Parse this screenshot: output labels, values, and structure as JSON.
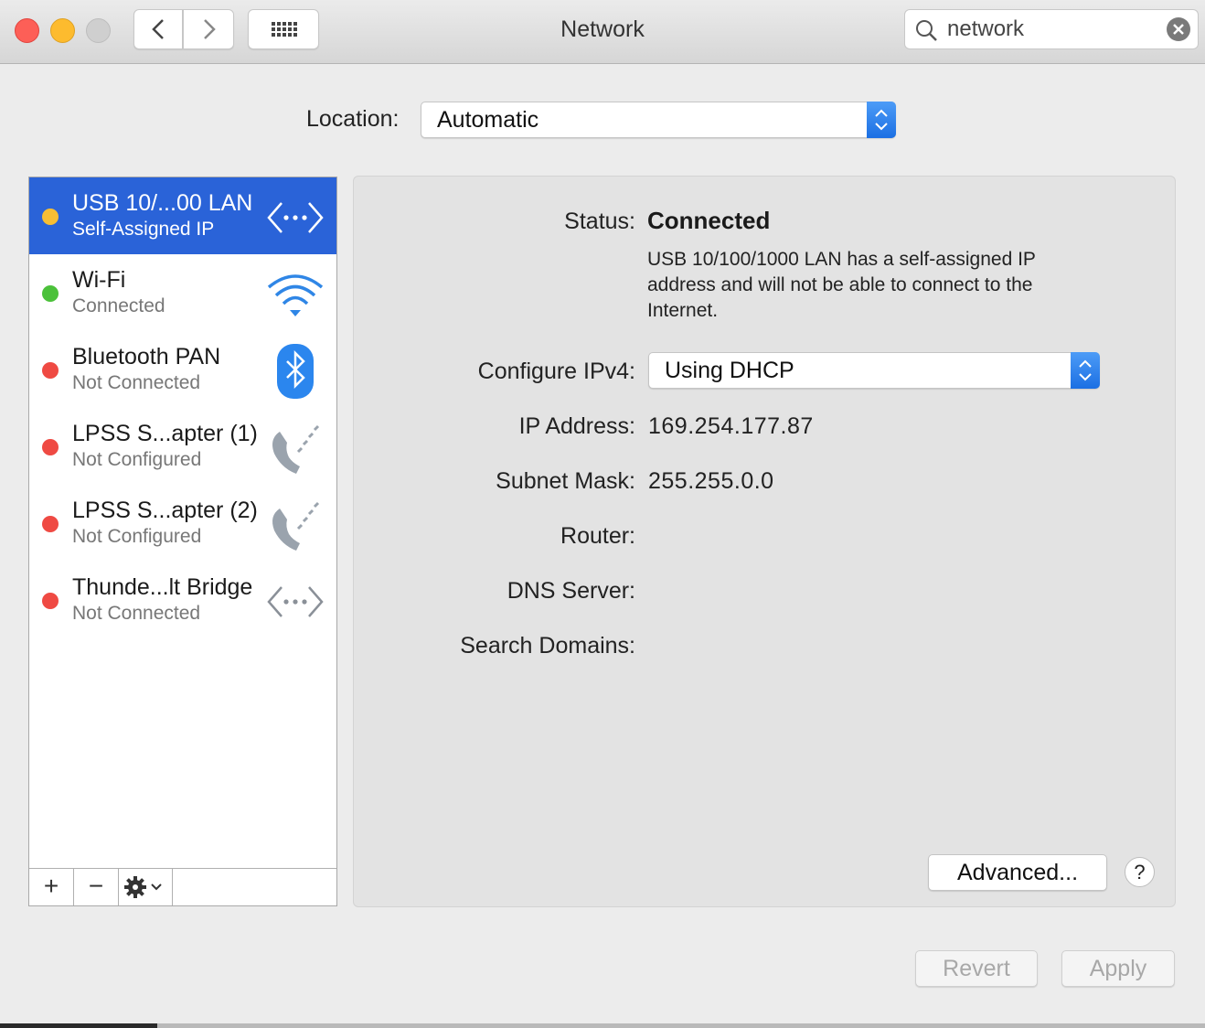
{
  "window": {
    "title": "Network"
  },
  "search": {
    "value": "network"
  },
  "location": {
    "label": "Location:",
    "value": "Automatic"
  },
  "services": [
    {
      "name": "USB 10/...00 LAN",
      "status": "Self-Assigned IP",
      "dot_color": "#f7be34",
      "icon": "ethernet-icon",
      "selected": true
    },
    {
      "name": "Wi-Fi",
      "status": "Connected",
      "dot_color": "#4bc13a",
      "icon": "wifi-icon"
    },
    {
      "name": "Bluetooth PAN",
      "status": "Not Connected",
      "dot_color": "#ef4a43",
      "icon": "bluetooth-icon"
    },
    {
      "name": "LPSS S...apter (1)",
      "status": "Not Configured",
      "dot_color": "#ef4a43",
      "icon": "phone-modem-icon"
    },
    {
      "name": "LPSS S...apter (2)",
      "status": "Not Configured",
      "dot_color": "#ef4a43",
      "icon": "phone-modem-icon"
    },
    {
      "name": "Thunde...lt Bridge",
      "status": "Not Connected",
      "dot_color": "#ef4a43",
      "icon": "ethernet-icon"
    }
  ],
  "tools": {
    "add": "+",
    "remove": "−"
  },
  "detail": {
    "status_label": "Status:",
    "status_value": "Connected",
    "status_description": "USB 10/100/1000 LAN has a self-assigned IP address and will not be able to connect to the Internet.",
    "configure_label": "Configure IPv4:",
    "configure_value": "Using DHCP",
    "ip_label": "IP Address:",
    "ip_value": "169.254.177.87",
    "subnet_label": "Subnet Mask:",
    "subnet_value": "255.255.0.0",
    "router_label": "Router:",
    "dns_label": "DNS Server:",
    "search_domains_label": "Search Domains:",
    "advanced_button": "Advanced...",
    "help_button": "?"
  },
  "footer": {
    "revert": "Revert",
    "apply": "Apply"
  },
  "colors": {
    "accent": "#2a63d8",
    "popup_arrow": "#1b6fe3"
  }
}
